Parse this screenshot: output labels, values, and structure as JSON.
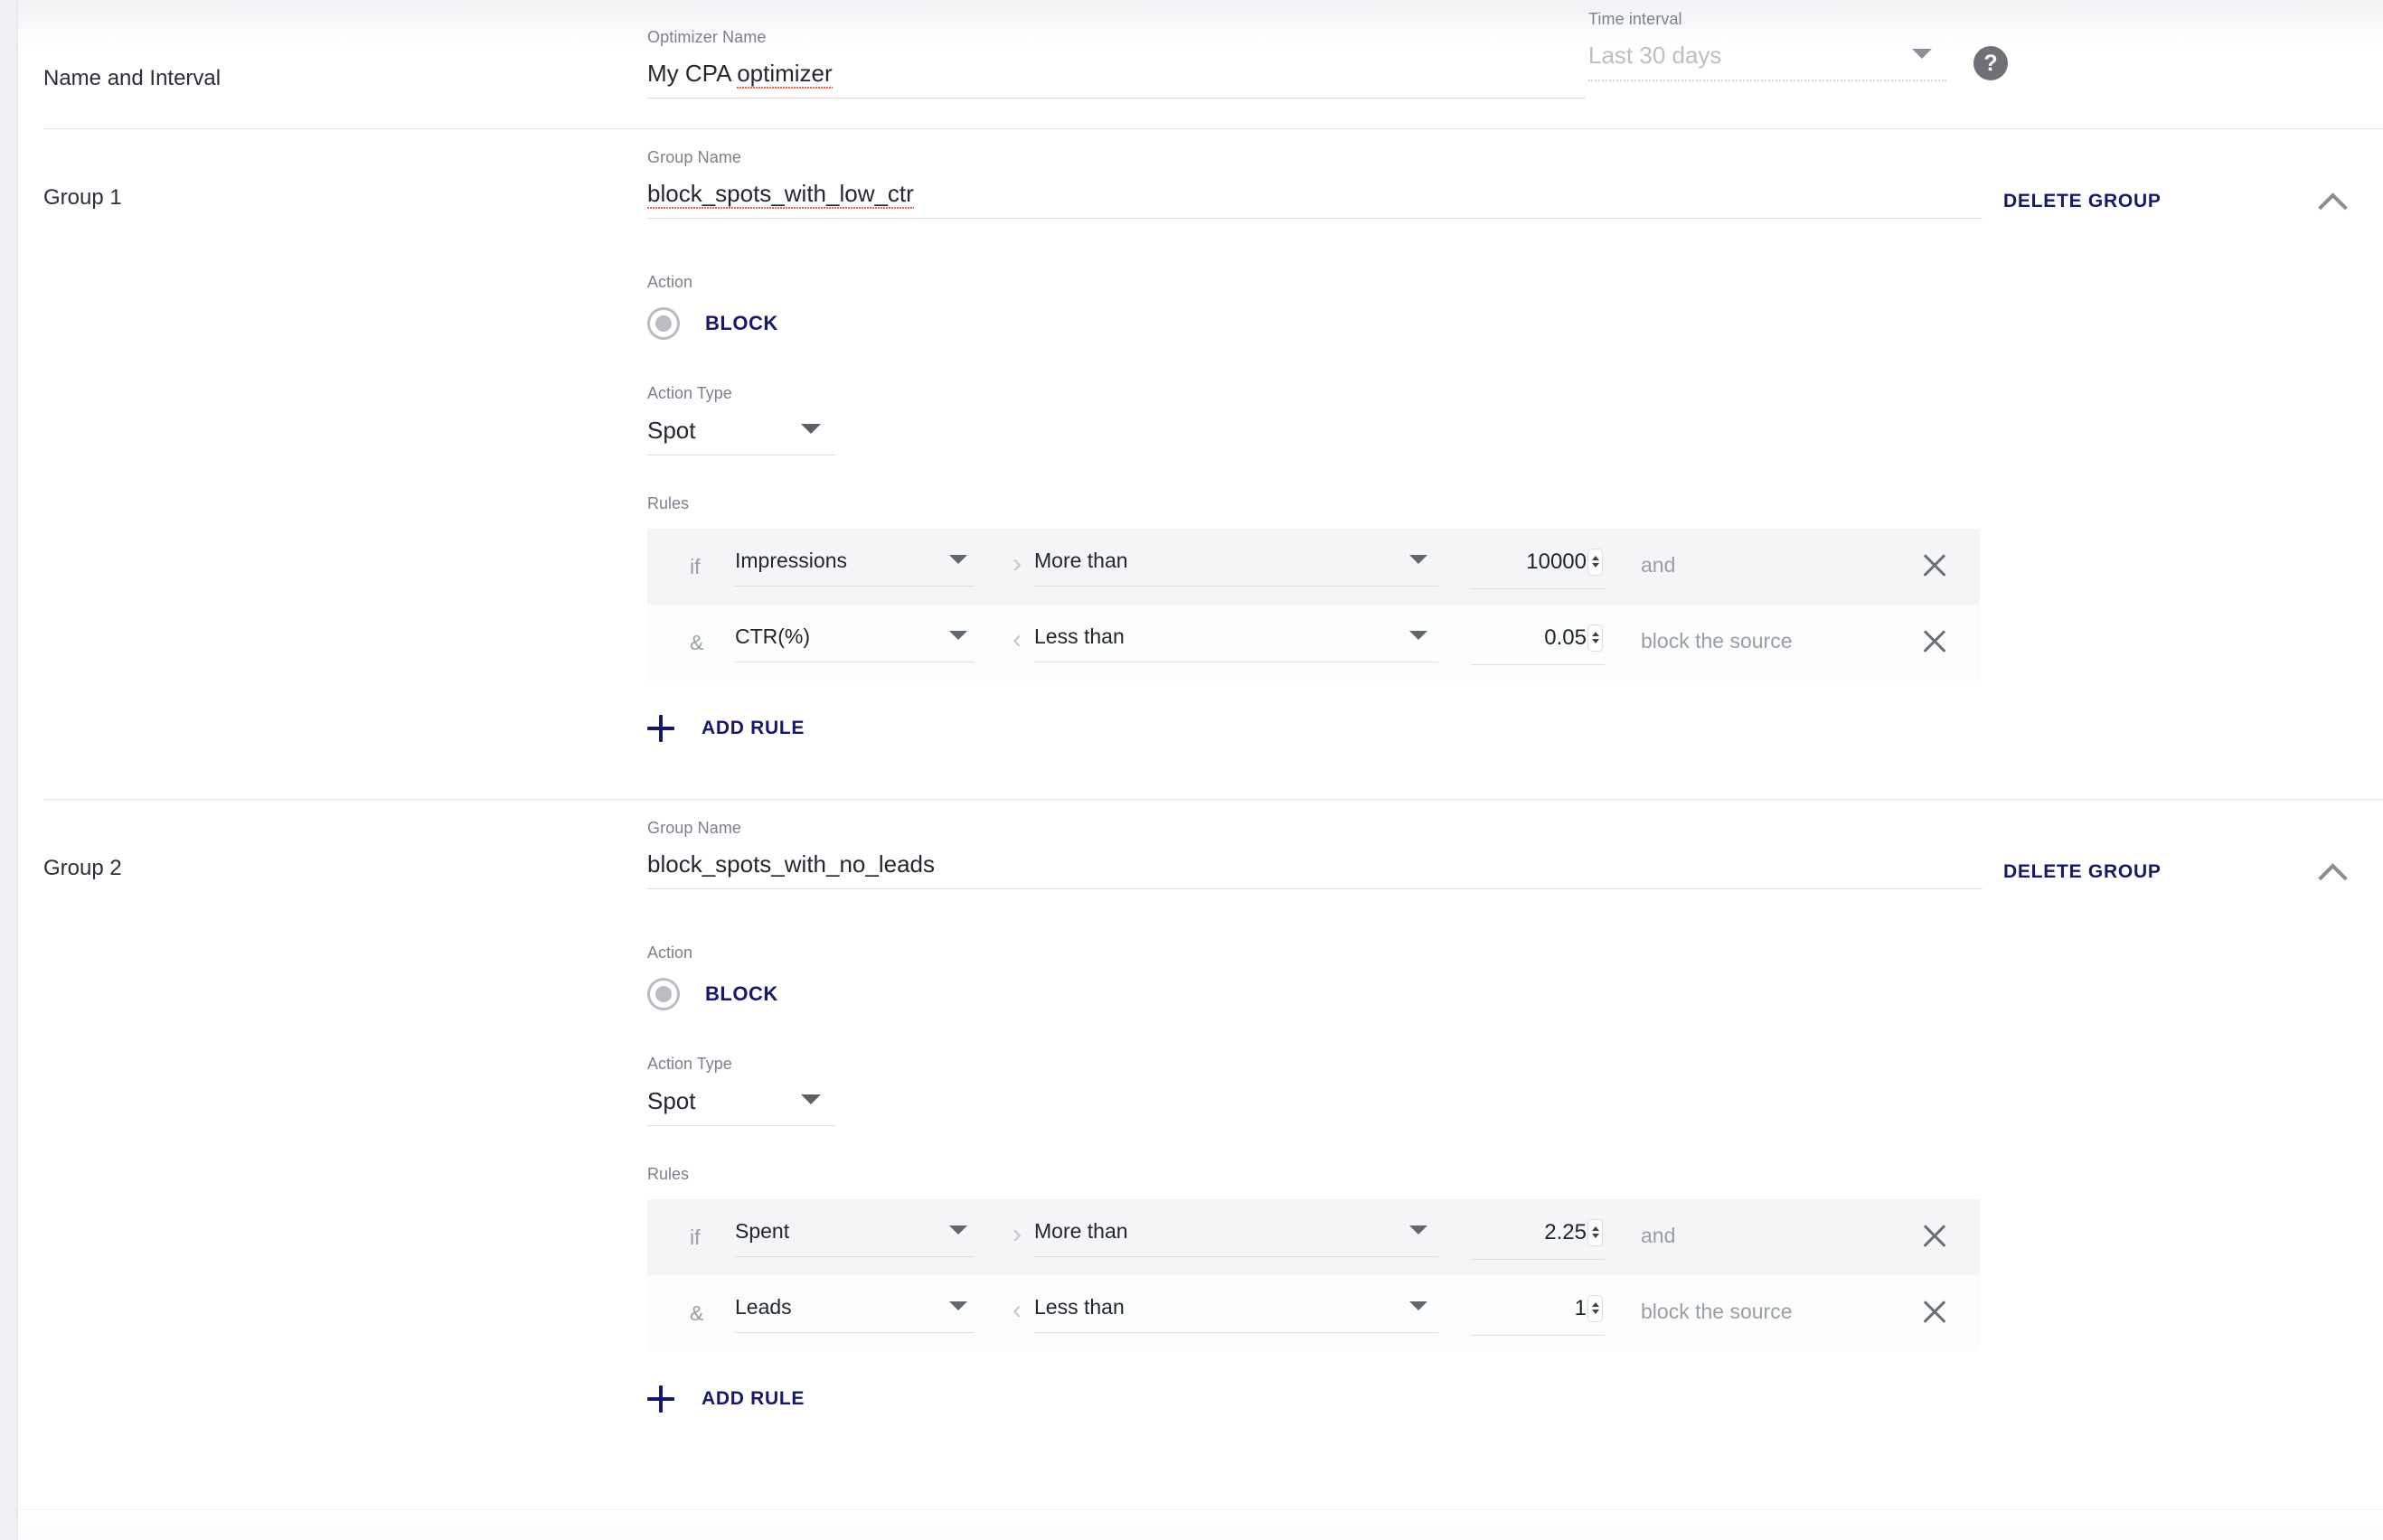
{
  "sections": {
    "name_interval": {
      "section_label": "Name and Interval",
      "optimizer_name_label": "Optimizer Name",
      "optimizer_name_value": "My CPA optimizer",
      "optimizer_name_spellcheck_word": "optimizer",
      "time_interval_label": "Time interval",
      "time_interval_value": "Last 30 days",
      "help_icon_glyph": "?"
    }
  },
  "common": {
    "group_name_label": "Group Name",
    "action_label": "Action",
    "action_type_label": "Action Type",
    "rules_label": "Rules",
    "delete_group_label": "DELETE GROUP",
    "add_rule_label": "ADD RULE",
    "prefix_if": "if",
    "prefix_and": "&",
    "tail_and": "and",
    "tail_block": "block the source",
    "gt_glyph": "›",
    "lt_glyph": "‹"
  },
  "groups": [
    {
      "title": "Group 1",
      "group_name_value": "block_spots_with_low_ctr",
      "action_value": "BLOCK",
      "action_type_value": "Spot",
      "rules": [
        {
          "prefix": "if",
          "metric": "Impressions",
          "cmp_glyph": "›",
          "operator": "More than",
          "value": "10000",
          "tail": "and"
        },
        {
          "prefix": "&",
          "metric": "CTR(%)",
          "cmp_glyph": "‹",
          "operator": "Less than",
          "value": "0.05",
          "tail": "block the source"
        }
      ]
    },
    {
      "title": "Group 2",
      "group_name_value": "block_spots_with_no_leads",
      "action_value": "BLOCK",
      "action_type_value": "Spot",
      "rules": [
        {
          "prefix": "if",
          "metric": "Spent",
          "cmp_glyph": "›",
          "operator": "More than",
          "value": "2.25",
          "tail": "and"
        },
        {
          "prefix": "&",
          "metric": "Leads",
          "cmp_glyph": "‹",
          "operator": "Less than",
          "value": "1",
          "tail": "block the source"
        }
      ]
    }
  ],
  "colors": {
    "accent_navy": "#15196b",
    "label_gray": "#7b808c",
    "text_dark": "#232730",
    "row_alt_bg": "#f4f5f7",
    "spellcheck_red": "#e8553c"
  }
}
